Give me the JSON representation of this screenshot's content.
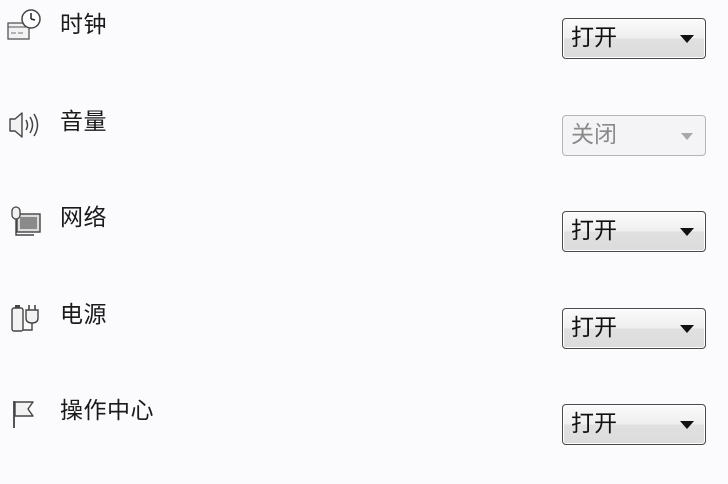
{
  "colors": {
    "background": "#fbfafc",
    "border": "#4a4a4a",
    "disabled_border": "#b5b5b5",
    "disabled_text": "#8a8a8a"
  },
  "rows": [
    {
      "icon": "clock-icon",
      "label": "时钟",
      "value": "打开",
      "enabled": true
    },
    {
      "icon": "volume-icon",
      "label": "音量",
      "value": "关闭",
      "enabled": false
    },
    {
      "icon": "network-icon",
      "label": "网络",
      "value": "打开",
      "enabled": true
    },
    {
      "icon": "power-icon",
      "label": "电源",
      "value": "打开",
      "enabled": true
    },
    {
      "icon": "action-center-icon",
      "label": "操作中心",
      "value": "打开",
      "enabled": true
    }
  ]
}
